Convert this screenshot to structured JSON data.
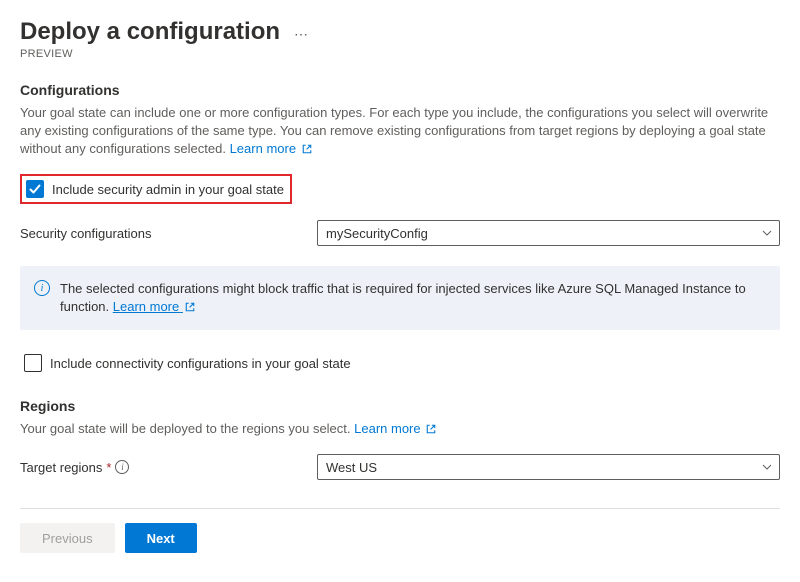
{
  "header": {
    "title": "Deploy a configuration",
    "preview": "PREVIEW"
  },
  "configurations": {
    "heading": "Configurations",
    "description_part1": "Your goal state can include one or more configuration types. For each type you include, the configurations you select will overwrite any existing configurations of the same type. You can remove existing configurations from target regions by deploying a goal state without any configurations selected. ",
    "learn_more": "Learn more",
    "include_security_label": "Include security admin in your goal state",
    "security_config_label": "Security configurations",
    "security_config_value": "mySecurityConfig",
    "banner_text_part1": "The selected configurations might block traffic that is required for injected services like Azure SQL Managed Instance to function.  ",
    "banner_learn_more": "Learn more",
    "include_connectivity_label": "Include connectivity configurations in your goal state"
  },
  "regions": {
    "heading": "Regions",
    "description_part1": "Your goal state will be deployed to the regions you select. ",
    "learn_more": "Learn more",
    "target_label": "Target regions",
    "target_value": "West US"
  },
  "footer": {
    "previous": "Previous",
    "next": "Next"
  }
}
